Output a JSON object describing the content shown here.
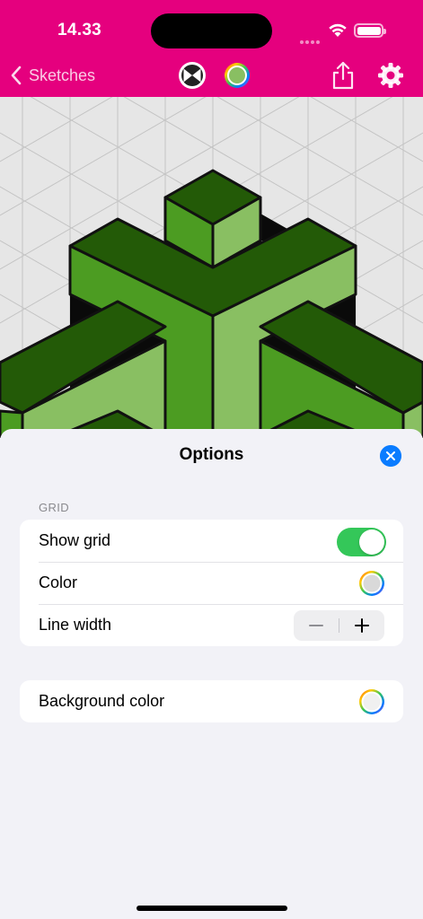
{
  "status_bar": {
    "time": "14.33"
  },
  "nav": {
    "back_label": "Sketches"
  },
  "options_sheet": {
    "title": "Options",
    "grid_section": {
      "header": "GRID",
      "rows": [
        {
          "label": "Show grid",
          "control": "toggle",
          "value": true
        },
        {
          "label": "Color",
          "control": "color-well"
        },
        {
          "label": "Line width",
          "control": "stepper"
        }
      ]
    },
    "background_row": {
      "label": "Background color",
      "control": "color-well"
    }
  },
  "colors": {
    "accent": "#e5007e",
    "toggle_on": "#34c759",
    "close_button": "#0a7cff",
    "cube_top": "#235a07",
    "cube_left": "#4c9c22",
    "cube_right": "#89bf62",
    "canvas_background": "#e6e6e6"
  }
}
